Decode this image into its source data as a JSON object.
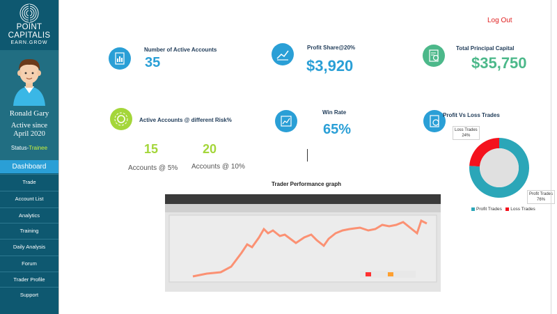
{
  "brand": {
    "name_line1": "POINT",
    "name_line2": "CAPITALIS",
    "tagline": "EARN.GROW"
  },
  "profile": {
    "name": "Ronald Gary",
    "active_line1": "Active since",
    "active_line2": "April 2020",
    "status_label": "Status-",
    "status_value": "Trainee"
  },
  "nav": {
    "dashboard": "Dashboard",
    "items": [
      "Trade",
      "Account List",
      "Analytics",
      "Training",
      "Daily Analysis",
      "Forum",
      "Trader Profile",
      "Support"
    ]
  },
  "header": {
    "logout": "Log Out"
  },
  "stats": {
    "active_accounts": {
      "label": "Number of Active Accounts",
      "value": "35",
      "color": "#2a9fd6"
    },
    "profit_share": {
      "label": "Profit Share@20%",
      "value": "$3,920",
      "color": "#2a9fd6"
    },
    "principal": {
      "label": "Total Principal Capital",
      "value": "$35,750",
      "color": "#4cb88a"
    },
    "risk": {
      "label": "Active Accounts @ different Risk%",
      "items": [
        {
          "value": "15",
          "caption": "Accounts @ 5%"
        },
        {
          "value": "20",
          "caption": "Accounts @ 10%"
        }
      ]
    },
    "win_rate": {
      "label": "Win Rate",
      "value": "65%",
      "color": "#2a9fd6"
    }
  },
  "graph": {
    "title": "Trader Performance graph"
  },
  "chart_data": {
    "type": "pie",
    "title": "Profit Vs Loss Trades",
    "categories": [
      "Profit Trades",
      "Loss Trades"
    ],
    "values": [
      76,
      24
    ],
    "labels": [
      "Profit Trades\n76%",
      "Loss Trades\n24%"
    ],
    "colors": [
      "#2ba6b8",
      "#f4121d"
    ],
    "legend": "bottom"
  },
  "colors": {
    "sidebar": "#0e5870",
    "accent_blue": "#2a9fd6",
    "accent_green": "#a4d63a",
    "logout_red": "#e02020"
  }
}
